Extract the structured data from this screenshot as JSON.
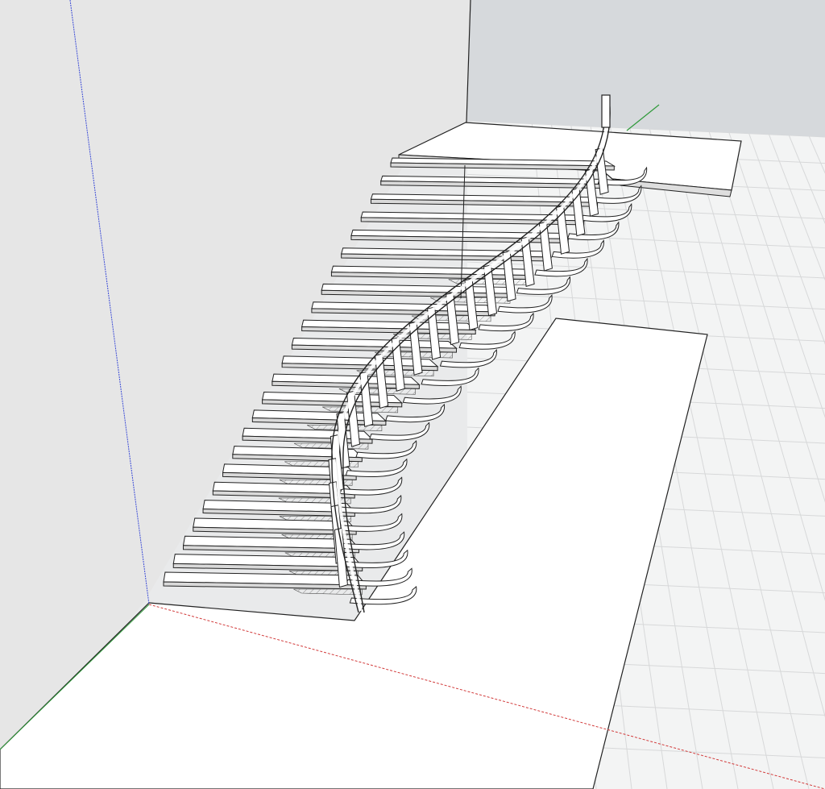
{
  "app": {
    "view": "3d-model-viewport",
    "projection": "perspective"
  },
  "scene": {
    "background_color": "#e9eaeb",
    "wall_color": "#e6e6e6",
    "wall_right_color": "#d6d9dc",
    "floor_color": "#ffffff",
    "ground_color": "#f3f4f4",
    "grid_line_color": "#d7d8d9",
    "edge_color": "#222222",
    "tread_top_color": "#ffffff",
    "tread_front_color": "#d9d9d9",
    "hatch_color": "#7a7a7a"
  },
  "axes": {
    "x_axis_color": "#d23b3b",
    "y_axis_color": "#2f9a3a",
    "z_axis_color": "#3b4bd6"
  },
  "model": {
    "object": "curved-staircase",
    "tread_count": 24,
    "baluster_count": 22,
    "has_handrail": true,
    "has_upper_landing": true
  }
}
